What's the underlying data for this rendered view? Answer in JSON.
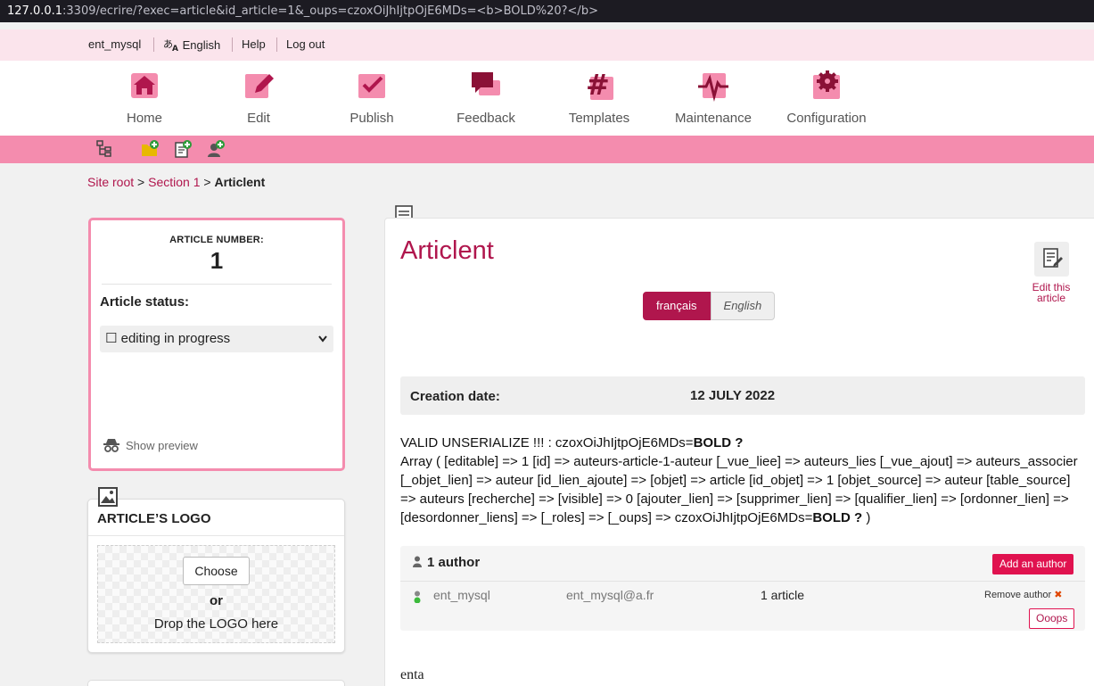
{
  "browser": {
    "url_host": "127.0.0.1",
    "url_rest": ":3309/ecrire/?exec=article&id_article=1&_oups=czoxOiJhIjtpOjE6MDs=<b>BOLD%20?</b>"
  },
  "userbar": {
    "username": "ent_mysql",
    "language": "English",
    "help": "Help",
    "logout": "Log out"
  },
  "nav": [
    {
      "label": "Home",
      "icon": "home-icon"
    },
    {
      "label": "Edit",
      "icon": "edit-icon"
    },
    {
      "label": "Publish",
      "icon": "publish-icon"
    },
    {
      "label": "Feedback",
      "icon": "feedback-icon"
    },
    {
      "label": "Templates",
      "icon": "templates-icon"
    },
    {
      "label": "Maintenance",
      "icon": "maintenance-icon"
    },
    {
      "label": "Configuration",
      "icon": "configuration-icon"
    }
  ],
  "toolbar_icons": [
    "site-tree-icon",
    "new-section-icon",
    "new-article-icon",
    "new-author-icon"
  ],
  "breadcrumb": {
    "root": "Site root",
    "sep1": ">",
    "section": "Section 1",
    "sep2": ">",
    "current": "Articlent"
  },
  "article_box": {
    "number_caption": "ARTICLE NUMBER:",
    "number": "1",
    "status_label": "Article status:",
    "status_value": "☐ editing in progress",
    "preview": "Show preview"
  },
  "logo_box": {
    "title": "ARTICLE’S LOGO",
    "choose": "Choose",
    "or": "or",
    "drop": "Drop the LOGO here"
  },
  "article": {
    "title": "Articlent",
    "edit_label": "Edit this article",
    "langs": [
      "français",
      "English"
    ],
    "creation_label": "Creation date:",
    "creation_value": "12 JULY 2022",
    "debug_prefix": "VALID UNSERIALIZE !!! : czoxOiJhIjtpOjE6MDs=",
    "debug_bold": "BOLD ?",
    "debug_body": "Array ( [editable] => 1 [id] => auteurs-article-1-auteur [_vue_liee] => auteurs_lies [_vue_ajout] => auteurs_associer [_objet_lien] => auteur [id_lien_ajoute] => [objet] => article [id_objet] => 1 [objet_source] => auteur [table_source] => auteurs [recherche] => [visible] => 0 [ajouter_lien] => [supprimer_lien] => [qualifier_lien] => [ordonner_lien] => [desordonner_liens] => [_roles] => [_oups] => czoxOiJhIjtpOjE6MDs=",
    "debug_bold2": "BOLD ?",
    "debug_tail": " )",
    "text": "enta"
  },
  "authors": {
    "header": "1 author",
    "add": "Add an author",
    "rows": [
      {
        "name": "ent_mysql",
        "email": "ent_mysql@a.fr",
        "articles": "1 article",
        "remove": "Remove author"
      }
    ],
    "oops": "Ooops"
  },
  "colors": {
    "accent": "#b0164d",
    "pink_bar": "#f48cae",
    "pink_light": "#fbe4ec",
    "button": "#e0124f"
  }
}
